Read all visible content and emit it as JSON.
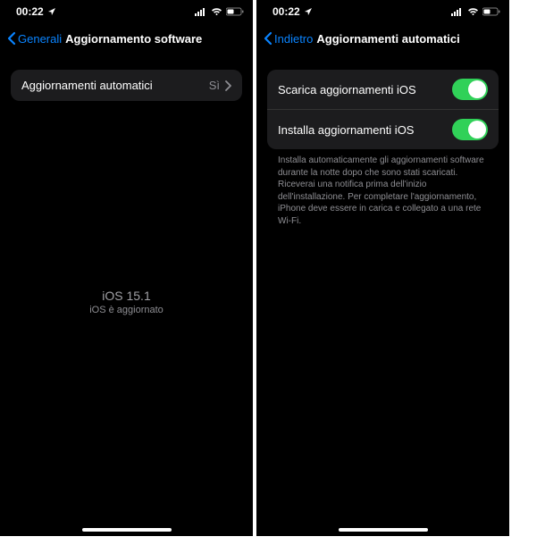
{
  "status": {
    "time": "00:22"
  },
  "screen1": {
    "back_label": "Generali",
    "title": "Aggiornamento software",
    "row": {
      "label": "Aggiornamenti automatici",
      "value": "Sì"
    },
    "version_line": "iOS 15.1",
    "version_sub": "iOS è aggiornato"
  },
  "screen2": {
    "back_label": "Indietro",
    "title": "Aggiornamenti automatici",
    "row1_label": "Scarica aggiornamenti iOS",
    "row2_label": "Installa aggiornamenti iOS",
    "footer": "Installa automaticamente gli aggiornamenti software durante la notte dopo che sono stati scaricati. Riceverai una notifica prima dell'inizio dell'installazione. Per completare l'aggiornamento, iPhone deve essere in carica e collegato a una rete Wi-Fi."
  }
}
